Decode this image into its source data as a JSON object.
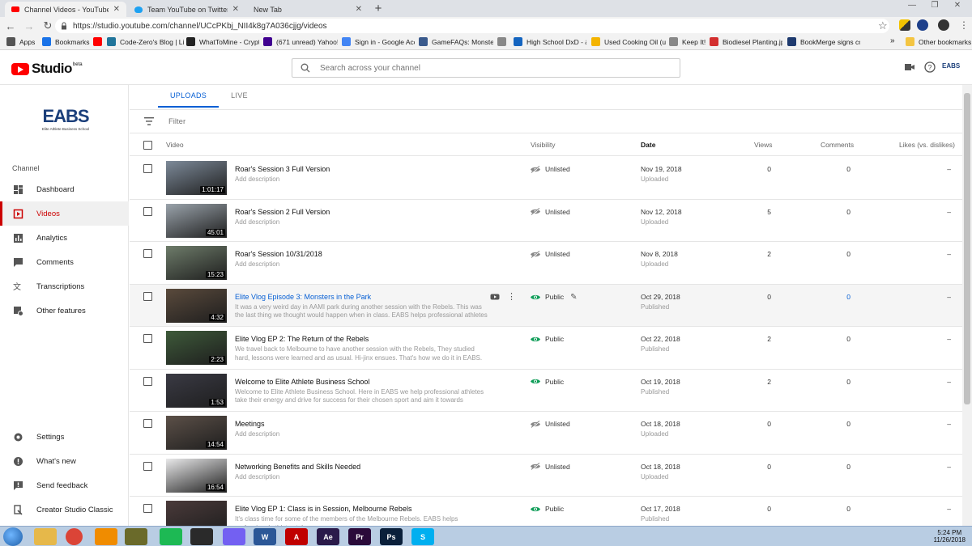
{
  "browser": {
    "tabs": [
      {
        "title": "Channel Videos - YouTube Studio",
        "active": true
      },
      {
        "title": "Team YouTube on Twitter: \"To co",
        "active": false
      },
      {
        "title": "New Tab",
        "active": false
      }
    ],
    "url": "https://studio.youtube.com/channel/UCcPKbj_NII4k8g7A036cjjg/videos",
    "new_tab": "+",
    "bookmarks": [
      {
        "label": "Apps",
        "icon": "apps-grid-icon",
        "color": "#555555"
      },
      {
        "label": "Bookmarks",
        "icon": "star-icon",
        "color": "#1a73e8"
      },
      {
        "label": "",
        "icon": "youtube-icon",
        "color": "#ff0000"
      },
      {
        "label": "Code-Zero's Blog | Li",
        "icon": "wordpress-icon",
        "color": "#21759b"
      },
      {
        "label": "WhatToMine - Crypt",
        "icon": "whattomine-icon",
        "color": "#222222"
      },
      {
        "label": "(671 unread) Yahoo!",
        "icon": "yahoo-icon",
        "color": "#400090"
      },
      {
        "label": "Sign in - Google Acc",
        "icon": "google-icon",
        "color": "#4285f4"
      },
      {
        "label": "GameFAQs: Monster",
        "icon": "gamefaqs-icon",
        "color": "#3a5a8c"
      },
      {
        "label": "",
        "icon": "page-icon",
        "color": "#888888"
      },
      {
        "label": "High School DxD - &",
        "icon": "blue-square-icon",
        "color": "#1565c0"
      },
      {
        "label": "Used Cooking Oil (u",
        "icon": "bookmark-icon",
        "color": "#f4b400"
      },
      {
        "label": "Keep It!",
        "icon": "page-icon",
        "color": "#888888"
      },
      {
        "label": "Biodiesel Planting.jp",
        "icon": "pinwheel-icon",
        "color": "#d32f2f"
      },
      {
        "label": "BookMerge signs co",
        "icon": "sb-icon",
        "color": "#1e3a6e"
      }
    ],
    "more_bookmarks": "»",
    "other_bookmarks": "Other bookmarks"
  },
  "studio": {
    "logo_text": "Studio",
    "logo_badge": "beta",
    "search_placeholder": "Search across your channel",
    "account_label": "EABS"
  },
  "sidebar": {
    "channel_logo": "EABS",
    "channel_logo_sub": "Elite Athlete Business School",
    "section_label": "Channel",
    "items": [
      {
        "label": "Dashboard",
        "icon": "dashboard-icon",
        "selected": false
      },
      {
        "label": "Videos",
        "icon": "videos-icon",
        "selected": true
      },
      {
        "label": "Analytics",
        "icon": "analytics-icon",
        "selected": false
      },
      {
        "label": "Comments",
        "icon": "comments-icon",
        "selected": false
      },
      {
        "label": "Transcriptions",
        "icon": "translate-icon",
        "selected": false
      },
      {
        "label": "Other features",
        "icon": "other-features-icon",
        "selected": false
      }
    ],
    "bottom_items": [
      {
        "label": "Settings",
        "icon": "gear-icon"
      },
      {
        "label": "What's new",
        "icon": "whats-new-icon"
      },
      {
        "label": "Send feedback",
        "icon": "feedback-icon"
      },
      {
        "label": "Creator Studio Classic",
        "icon": "classic-studio-icon"
      }
    ]
  },
  "main": {
    "tabs": [
      {
        "label": "UPLOADS",
        "active": true
      },
      {
        "label": "LIVE",
        "active": false
      }
    ],
    "filter_placeholder": "Filter",
    "columns": {
      "video": "Video",
      "visibility": "Visibility",
      "date": "Date",
      "views": "Views",
      "comments": "Comments",
      "likes": "Likes (vs. dislikes)"
    },
    "videos": [
      {
        "title": "Roar's Session 3 Full Version",
        "description": "Add description",
        "duration": "1:01:17",
        "visibility": "Unlisted",
        "date": "Nov 19, 2018",
        "status": "Uploaded",
        "views": "0",
        "comments": "0",
        "likes": "–",
        "thumb_color": "#7d8a99"
      },
      {
        "title": "Roar's Session 2 Full Version",
        "description": "Add description",
        "duration": "45:01",
        "visibility": "Unlisted",
        "date": "Nov 12, 2018",
        "status": "Uploaded",
        "views": "5",
        "comments": "0",
        "likes": "–",
        "thumb_color": "#9aa3ab"
      },
      {
        "title": "Roar's Session 10/31/2018",
        "description": "Add description",
        "duration": "15:23",
        "visibility": "Unlisted",
        "date": "Nov 8, 2018",
        "status": "Uploaded",
        "views": "2",
        "comments": "0",
        "likes": "–",
        "thumb_color": "#6e7c6a"
      },
      {
        "title": "Elite Vlog Episode 3: Monsters in the Park",
        "description": "It was a very weird day in AAMI park during another session with the Rebels. This was the last thing we thought would happen when in class. EABS helps professional athletes take...",
        "duration": "4:32",
        "visibility": "Public",
        "date": "Oct 29, 2018",
        "status": "Published",
        "views": "0",
        "comments": "0",
        "likes": "–",
        "thumb_color": "#5a4a3c"
      },
      {
        "title": "Elite Vlog EP 2: The Return of the Rebels",
        "description": "We travel back to Melbourne to have another session with the Rebels, They studied hard, lessons were learned and as usual. Hi-jinx ensues. That's how we do it in EABS. We study...",
        "duration": "2:23",
        "visibility": "Public",
        "date": "Oct 22, 2018",
        "status": "Published",
        "views": "2",
        "comments": "0",
        "likes": "–",
        "thumb_color": "#3e5a3a"
      },
      {
        "title": "Welcome to Elite Athlete Business School",
        "description": "Welcome to Elite Athlete Business School. Here in EABS we help professional athletes take their energy and drive for success for their chosen sport and aim it towards success in...",
        "duration": "1:53",
        "visibility": "Public",
        "date": "Oct 19, 2018",
        "status": "Published",
        "views": "2",
        "comments": "0",
        "likes": "–",
        "thumb_color": "#3a3a44"
      },
      {
        "title": "Meetings",
        "description": "Add description",
        "duration": "14:54",
        "visibility": "Unlisted",
        "date": "Oct 18, 2018",
        "status": "Uploaded",
        "views": "0",
        "comments": "0",
        "likes": "–",
        "thumb_color": "#5c5048"
      },
      {
        "title": "Networking Benefits and Skills Needed",
        "description": "Add description",
        "duration": "16:54",
        "visibility": "Unlisted",
        "date": "Oct 18, 2018",
        "status": "Uploaded",
        "views": "0",
        "comments": "0",
        "likes": "–",
        "thumb_color": "#e9e9ea"
      },
      {
        "title": "Elite Vlog EP 1: Class is in Session, Melbourne Rebels",
        "description": "It's class time for some of the members of the Melbourne Rebels. EABS helps professional athletes take...",
        "duration": "",
        "visibility": "Public",
        "date": "Oct 17, 2018",
        "status": "Published",
        "views": "0",
        "comments": "0",
        "likes": "–",
        "thumb_color": "#4a3a3a"
      }
    ]
  },
  "taskbar": {
    "apps": [
      {
        "icon": "file-explorer-icon",
        "label": "",
        "color": "#e6b84a"
      },
      {
        "icon": "chrome-icon",
        "label": "",
        "color": "#db4437"
      },
      {
        "icon": "vlc-icon",
        "label": "",
        "color": "#f08c00"
      },
      {
        "icon": "app-icon",
        "label": "",
        "color": "#6a6a2a"
      },
      {
        "icon": "spotify-icon",
        "label": "",
        "color": "#1db954"
      },
      {
        "icon": "clock-icon",
        "label": "",
        "color": "#2a2a2a"
      },
      {
        "icon": "viber-icon",
        "label": "",
        "color": "#7360f2"
      },
      {
        "icon": "word-icon",
        "label": "W",
        "color": "#2b5797"
      },
      {
        "icon": "acrobat-icon",
        "label": "A",
        "color": "#c00000"
      },
      {
        "icon": "after-effects-icon",
        "label": "Ae",
        "color": "#2a1a4a"
      },
      {
        "icon": "premiere-icon",
        "label": "Pr",
        "color": "#2a0a3a"
      },
      {
        "icon": "photoshop-icon",
        "label": "Ps",
        "color": "#0a1f3a"
      },
      {
        "icon": "skype-icon",
        "label": "S",
        "color": "#00aff0"
      }
    ],
    "time": "5:24 PM",
    "date": "11/26/2018"
  },
  "colors": {
    "accent_blue": "#065fd4",
    "selected_red": "#cc0000",
    "public_green": "#0f9d58",
    "youtube_red": "#ff0000"
  }
}
